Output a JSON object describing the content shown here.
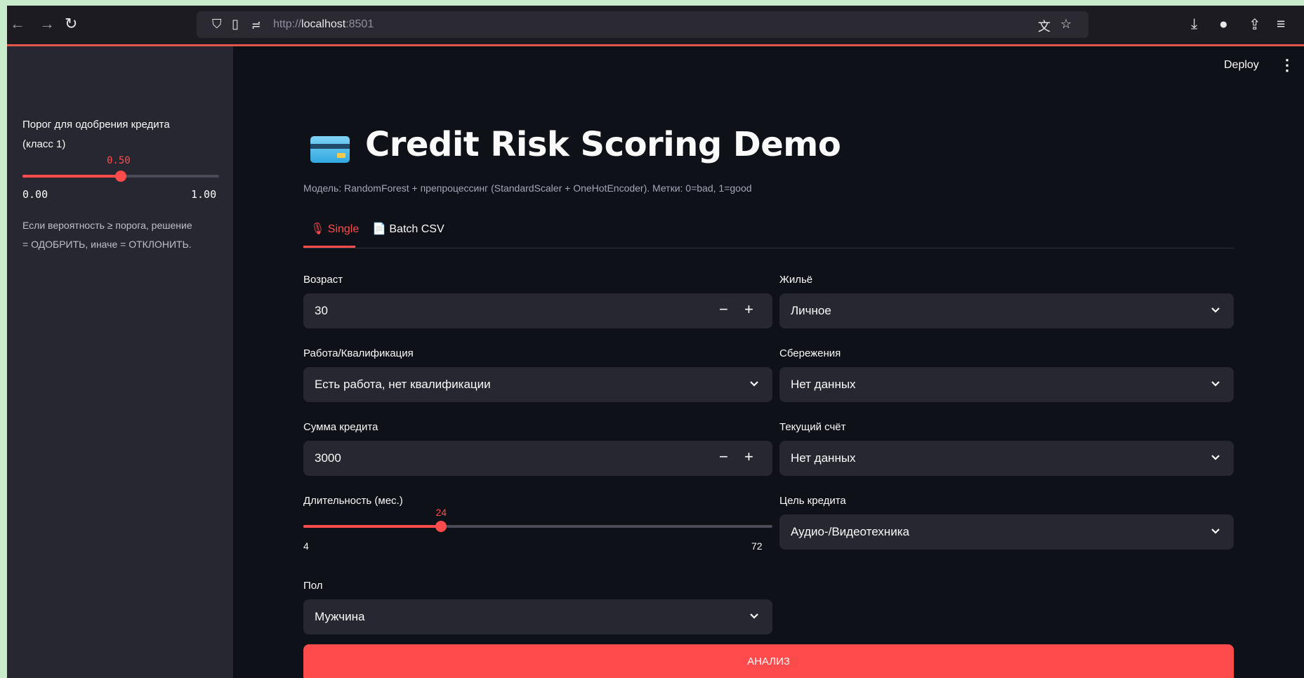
{
  "browser": {
    "url_prefix": "http://",
    "url_host": "localhost",
    "url_port": ":8501"
  },
  "sidebar": {
    "threshold_label": "Порог для одобрения кредита (класс 1)",
    "threshold_value_text": "0.50",
    "threshold_value": 0.5,
    "threshold_min": "0.00",
    "threshold_max": "1.00",
    "help_text": "Если вероятность ≥ порога, решение = ОДОБРИТЬ, иначе = ОТКЛОНИТЬ."
  },
  "header": {
    "deploy_label": "Deploy"
  },
  "main": {
    "title": "Credit Risk Scoring Demo",
    "caption": "Модель: RandomForest + препроцессинг (StandardScaler + OneHotEncoder). Метки: 0=bad, 1=good",
    "tabs": [
      {
        "label": "Single"
      },
      {
        "label": "Batch CSV"
      }
    ],
    "age": {
      "label": "Возраст",
      "value": "30"
    },
    "job": {
      "label": "Работа/Квалификация",
      "value": "Есть работа, нет квалификации"
    },
    "credit_amount": {
      "label": "Сумма кредита",
      "value": "3000"
    },
    "duration": {
      "label": "Длительность (мес.)",
      "value_text": "24",
      "value": 24,
      "min": "4",
      "max": "72"
    },
    "sex": {
      "label": "Пол",
      "value": "Мужчина"
    },
    "housing": {
      "label": "Жильё",
      "value": "Личное"
    },
    "savings": {
      "label": "Сбережения",
      "value": "Нет данных"
    },
    "checking": {
      "label": "Текущий счёт",
      "value": "Нет данных"
    },
    "purpose": {
      "label": "Цель кредита",
      "value": "Аудио-/Видеотехника"
    },
    "submit_label": "АНАЛИЗ"
  },
  "colors": {
    "accent": "#ff4b4b",
    "background": "#0e1117",
    "sidebar": "#262730"
  }
}
